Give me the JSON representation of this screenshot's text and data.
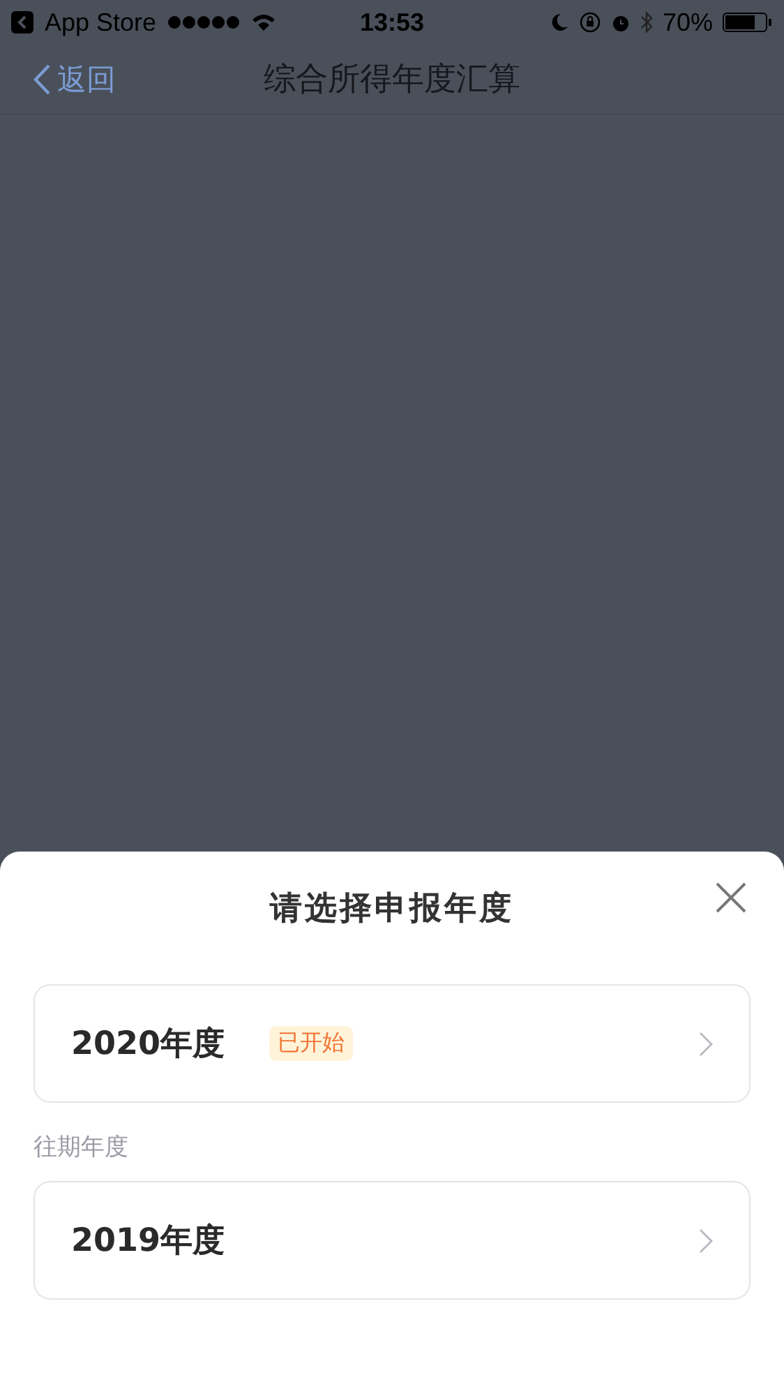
{
  "status_bar": {
    "back_app": "App Store",
    "time": "13:53",
    "battery": "70%"
  },
  "nav": {
    "back": "返回",
    "title": "综合所得年度汇算"
  },
  "sheet": {
    "title": "请选择申报年度",
    "current": [
      {
        "label": "2020年度",
        "badge": "已开始"
      }
    ],
    "past_heading": "往期年度",
    "past": [
      {
        "label": "2019年度"
      }
    ]
  }
}
